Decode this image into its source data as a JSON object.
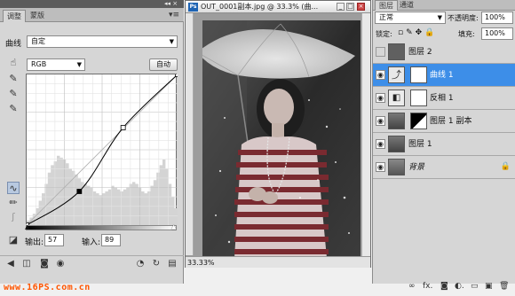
{
  "adjustments": {
    "tabs": [
      "调整",
      "蒙版"
    ],
    "panel_controls": "◂◂ ×",
    "menu_icon": "▾≡",
    "header_label": "曲线",
    "preset_value": "自定",
    "channel_value": "RGB",
    "auto_label": "自动",
    "output_label": "输出:",
    "output_value": "57",
    "input_label": "输入:",
    "input_value": "89",
    "curve_points_0_255": [
      [
        0,
        0
      ],
      [
        89,
        57
      ],
      [
        163,
        165
      ],
      [
        255,
        255
      ]
    ],
    "histogram": [
      5,
      8,
      12,
      18,
      26,
      34,
      44,
      56,
      64,
      68,
      74,
      72,
      70,
      66,
      60,
      58,
      54,
      50,
      46,
      44,
      42,
      40,
      36,
      34,
      32,
      34,
      36,
      38,
      42,
      40,
      38,
      36,
      38,
      40,
      44,
      46,
      44,
      40,
      36,
      34,
      36,
      42,
      48,
      56,
      64,
      70,
      60,
      44,
      30,
      18
    ],
    "icons": {
      "hand": "hand-adjust-icon",
      "eyedropper_black": "eyedropper-black-icon",
      "eyedropper_gray": "eyedropper-gray-icon",
      "eyedropper_white": "eyedropper-white-icon",
      "curve_tool": "curve-point-tool-icon",
      "pencil": "pencil-draw-icon",
      "smooth": "smooth-icon",
      "clip": "clip-to-layer-icon"
    }
  },
  "document": {
    "title": "OUT_0001副本.jpg @ 33.3% (曲...",
    "zoom": "33.33%",
    "app_icon": "Ps"
  },
  "layers": {
    "tabs": [
      "图层",
      "通道"
    ],
    "blend_mode": "正常",
    "opacity_label": "不透明度:",
    "opacity_value": "100%",
    "lock_label": "锁定:",
    "fill_label": "填充:",
    "fill_value": "100%",
    "items": [
      {
        "name": "图层 2",
        "visible": false,
        "selected": false
      },
      {
        "name": "曲线 1",
        "visible": true,
        "selected": true
      },
      {
        "name": "反相 1",
        "visible": true,
        "selected": false
      },
      {
        "name": "图层 1 副本",
        "visible": true,
        "selected": false
      },
      {
        "name": "图层 1",
        "visible": true,
        "selected": false
      },
      {
        "name": "背景",
        "visible": true,
        "selected": false
      }
    ],
    "footer_icons": [
      "∞",
      "fx.",
      "◙",
      "◐.",
      "▭",
      "▣",
      "🗑"
    ]
  },
  "watermark": "www.16PS.com.cn"
}
